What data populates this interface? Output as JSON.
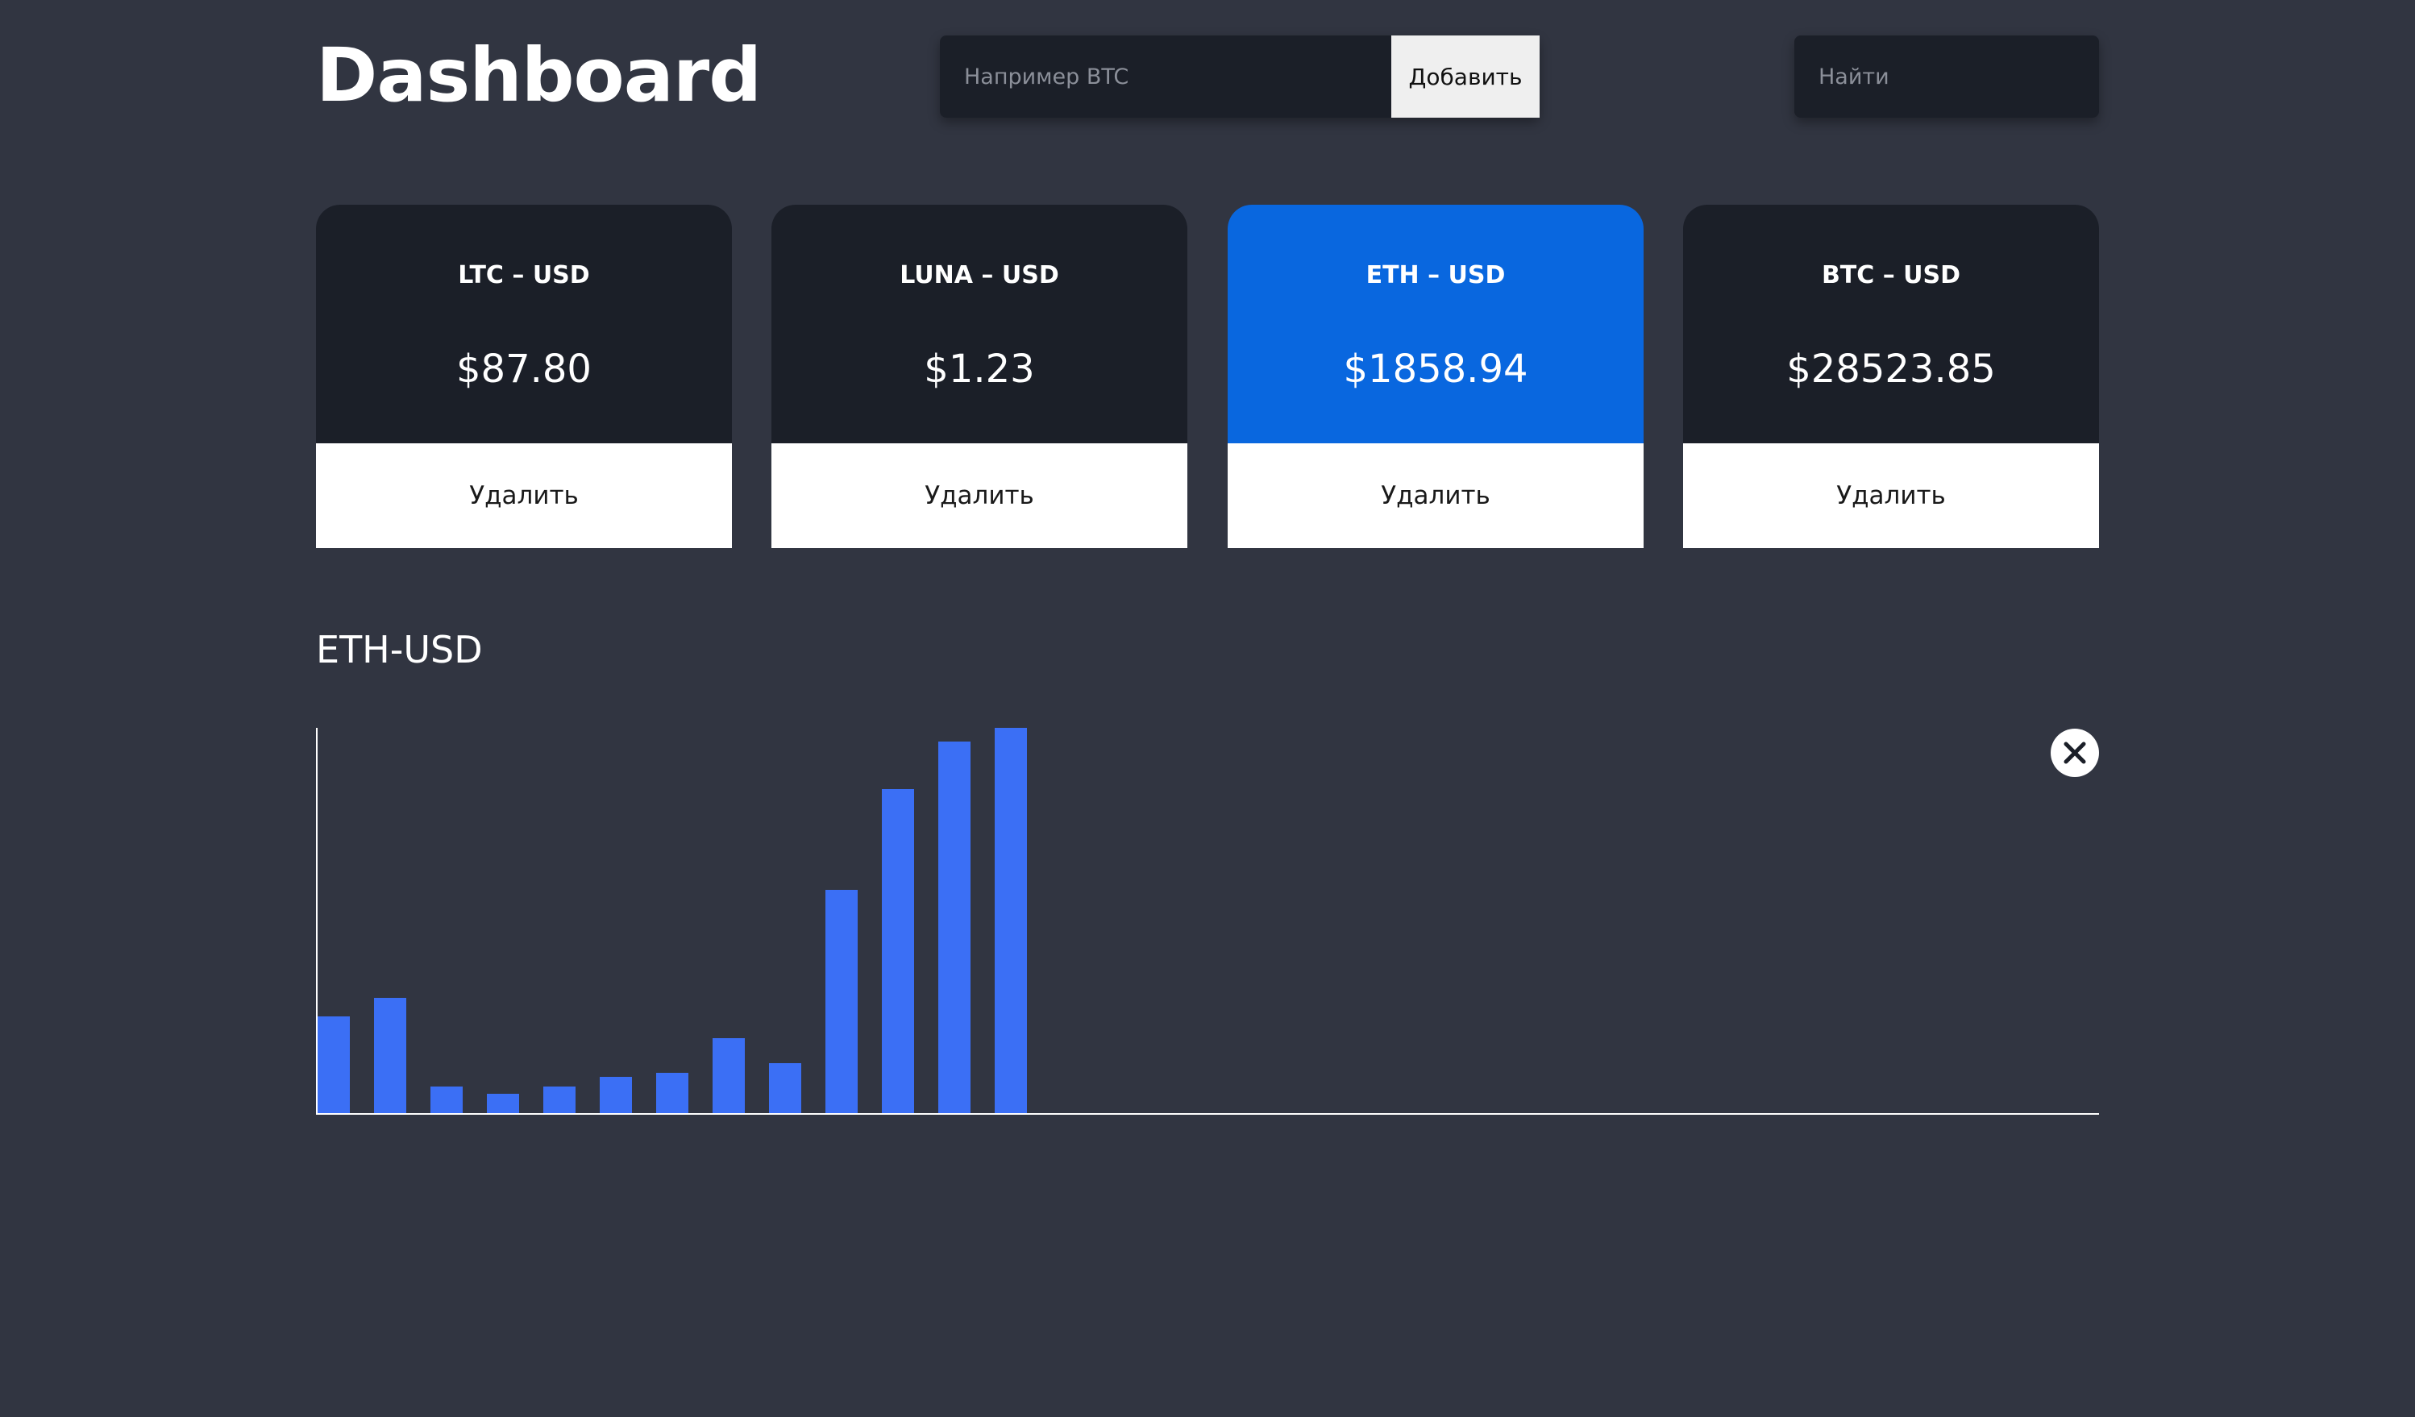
{
  "header": {
    "title": "Dashboard",
    "add_placeholder": "Например BTC",
    "add_label": "Добавить",
    "search_placeholder": "Найти"
  },
  "cards": [
    {
      "pair": "LTC – USD",
      "price": "$87.80",
      "delete_label": "Удалить",
      "active": false
    },
    {
      "pair": "LUNA – USD",
      "price": "$1.23",
      "delete_label": "Удалить",
      "active": false
    },
    {
      "pair": "ETH – USD",
      "price": "$1858.94",
      "delete_label": "Удалить",
      "active": true
    },
    {
      "pair": "BTC – USD",
      "price": "$28523.85",
      "delete_label": "Удалить",
      "active": false
    }
  ],
  "chart": {
    "title": "ETH-USD",
    "close_icon": "close-icon"
  },
  "colors": {
    "background": "#313541",
    "card": "#1b1f28",
    "active_card": "#0967df",
    "bar": "#3b6ff5"
  },
  "chart_data": {
    "type": "bar",
    "title": "ETH-USD",
    "values": [
      0.25,
      0.3,
      0.07,
      0.05,
      0.07,
      0.095,
      0.105,
      0.195,
      0.13,
      0.58,
      0.84,
      0.965,
      1.0
    ],
    "ylim": [
      0,
      1
    ],
    "grid": false
  }
}
